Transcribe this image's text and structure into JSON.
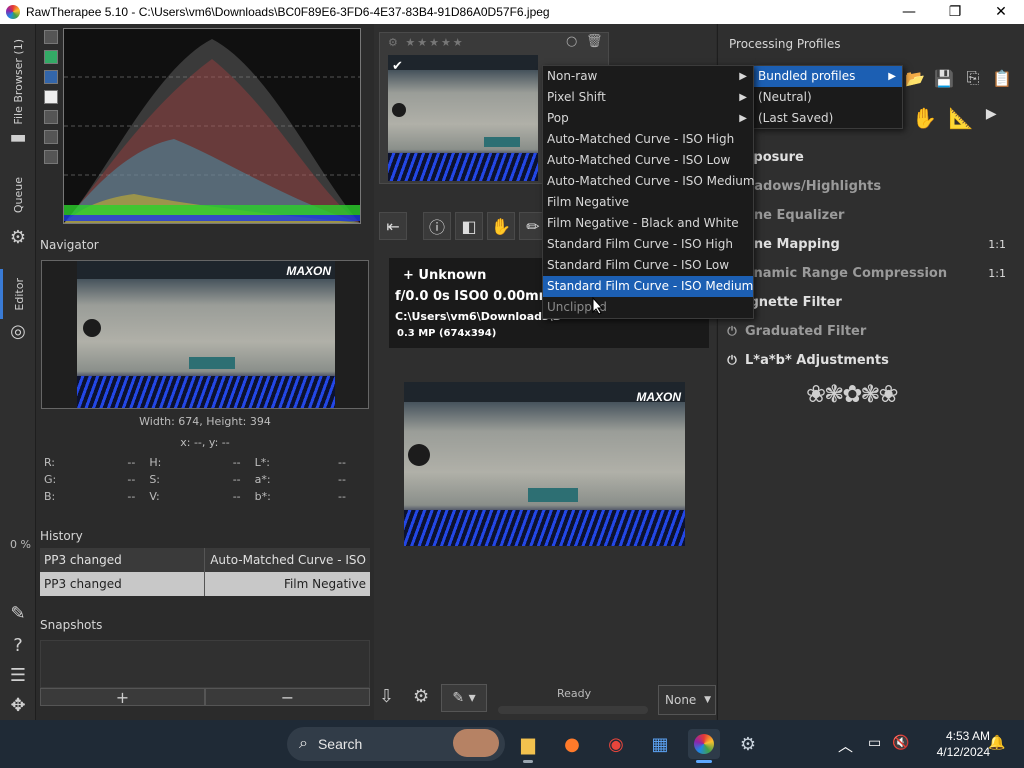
{
  "window": {
    "title": "RawTherapee 5.10 - C:\\Users\\vm6\\Downloads\\BC0F89E6-3FD6-4E37-83B4-91D86A0D57F6.jpeg",
    "minimize": "—",
    "maximize": "❐",
    "close": "✕"
  },
  "vstrip": {
    "file_browser": "File Browser (1)",
    "queue": "Queue",
    "editor": "Editor",
    "zoom_pct": "0 %"
  },
  "navigator": {
    "label": "Navigator",
    "size": "Width: 674, Height: 394",
    "coords": "x: --, y: --",
    "photo_brand": "MAXON"
  },
  "readout": [
    [
      {
        "k": "R:",
        "v": "--"
      },
      {
        "k": "H:",
        "v": "--"
      },
      {
        "k": "L*:",
        "v": "--"
      }
    ],
    [
      {
        "k": "G:",
        "v": "--"
      },
      {
        "k": "S:",
        "v": "--"
      },
      {
        "k": "a*:",
        "v": "--"
      }
    ],
    [
      {
        "k": "B:",
        "v": "--"
      },
      {
        "k": "V:",
        "v": "--"
      },
      {
        "k": "b*:",
        "v": "--"
      }
    ]
  ],
  "history": {
    "label": "History",
    "rows": [
      {
        "action": "PP3 changed",
        "detail": "Auto-Matched Curve - ISO ..."
      },
      {
        "action": "PP3 changed",
        "detail": "Film Negative"
      }
    ]
  },
  "snapshots": {
    "label": "Snapshots",
    "add": "+",
    "remove": "−"
  },
  "info": {
    "camera": "+ Unknown",
    "exif": "f/0.0  0s  ISO0  0.00mm",
    "path": "C:\\Users\\vm6\\Downloads\\B",
    "mp": "0.3 MP (674x394)"
  },
  "status": {
    "ready": "Ready",
    "output": "None"
  },
  "profiles": {
    "label": "Processing Profiles",
    "menu1": [
      {
        "label": "Bundled profiles",
        "submenu": true,
        "highlight": true
      },
      {
        "label": "(Neutral)",
        "submenu": false,
        "highlight": false
      },
      {
        "label": "(Last Saved)",
        "submenu": false,
        "highlight": false
      }
    ],
    "menu2": [
      {
        "label": "Non-raw",
        "submenu": true,
        "highlight": false
      },
      {
        "label": "Pixel Shift",
        "submenu": true,
        "highlight": false
      },
      {
        "label": "Pop",
        "submenu": true,
        "highlight": false
      },
      {
        "label": "Auto-Matched Curve - ISO High",
        "submenu": false,
        "highlight": false
      },
      {
        "label": "Auto-Matched Curve - ISO Low",
        "submenu": false,
        "highlight": false
      },
      {
        "label": "Auto-Matched Curve - ISO Medium",
        "submenu": false,
        "highlight": false
      },
      {
        "label": "Film Negative",
        "submenu": false,
        "highlight": false
      },
      {
        "label": "Film Negative - Black and White",
        "submenu": false,
        "highlight": false
      },
      {
        "label": "Standard Film Curve - ISO High",
        "submenu": false,
        "highlight": false
      },
      {
        "label": "Standard Film Curve - ISO Low",
        "submenu": false,
        "highlight": false
      },
      {
        "label": "Standard Film Curve - ISO Medium",
        "submenu": false,
        "highlight": true
      },
      {
        "label": "Unclipped",
        "submenu": false,
        "highlight": false
      }
    ]
  },
  "tools": [
    {
      "label": "xposure",
      "value": "",
      "dim": false
    },
    {
      "label": "hadows/Highlights",
      "value": "",
      "dim": true
    },
    {
      "label": "one Equalizer",
      "value": "",
      "dim": true
    },
    {
      "label": "one Mapping",
      "value": "1:1",
      "dim": false
    },
    {
      "label": "ynamic Range Compression",
      "value": "1:1",
      "dim": true
    },
    {
      "label": "ignette Filter",
      "value": "",
      "dim": false
    },
    {
      "label": "Graduated Filter",
      "value": "",
      "dim": true
    },
    {
      "label": "L*a*b* Adjustments",
      "value": "",
      "dim": false
    }
  ],
  "taskbar": {
    "search": "Search",
    "time": "4:53 AM",
    "date": "4/12/2024"
  }
}
